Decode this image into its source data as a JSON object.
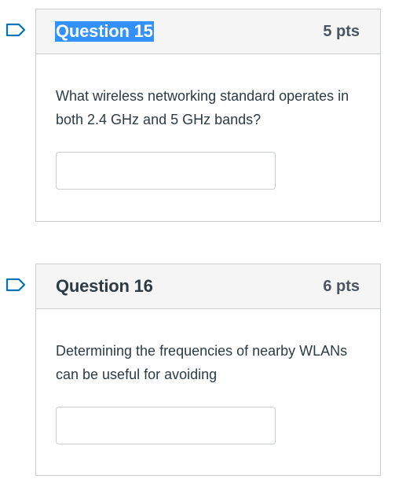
{
  "questions": [
    {
      "title": "Question 15",
      "points": "5 pts",
      "text": "What wireless networking standard operates in both 2.4 GHz and 5 GHz bands?",
      "answer_value": "",
      "title_selected": true
    },
    {
      "title": "Question 16",
      "points": "6 pts",
      "text": "Determining the frequencies of nearby WLANs can be useful for avoiding",
      "answer_value": "",
      "title_selected": false
    }
  ],
  "icons": {
    "flag": "bookmark-flag-icon"
  },
  "colors": {
    "flag_stroke": "#0374b5",
    "selection": "#3390ff",
    "header_bg": "#f5f5f5",
    "border": "#c7cdd1",
    "text": "#2d3b45"
  }
}
